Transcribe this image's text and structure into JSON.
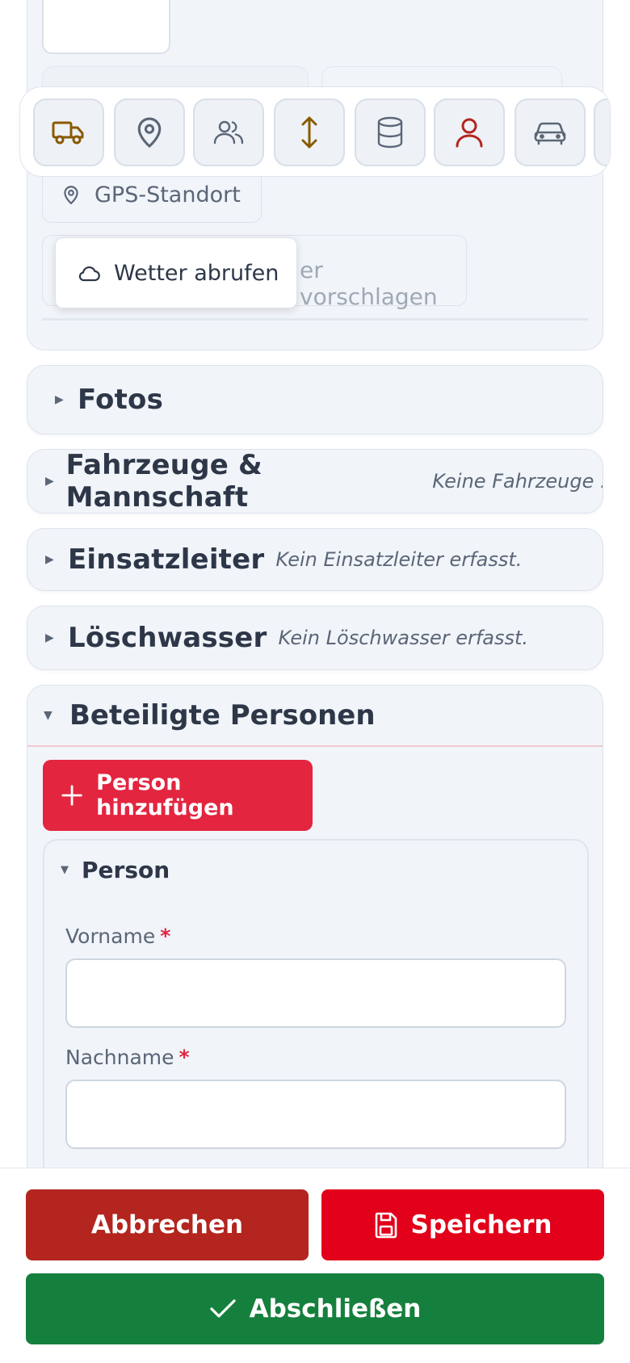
{
  "location": {
    "gps_label": "GPS-Standort",
    "suggest_label_visible": "er vorschlagen",
    "weather_label": "Wetter abrufen"
  },
  "toolbar": {
    "icons": [
      "truck-icon",
      "map-pin-icon",
      "users-icon",
      "arrows-up-down-icon",
      "database-icon",
      "user-icon",
      "car-icon"
    ],
    "colors": {
      "active": "#8a5a00",
      "person": "#b3251e",
      "default": "#5b6677"
    }
  },
  "sections": {
    "fotos": {
      "title": "Fotos"
    },
    "fahrzeuge": {
      "title": "Fahrzeuge & Mannschaft",
      "note": "Keine Fahrzeuge ..."
    },
    "einsatzleiter": {
      "title": "Einsatzleiter",
      "note": "Kein Einsatzleiter erfasst."
    },
    "loeschwasser": {
      "title": "Löschwasser",
      "note": "Kein Löschwasser erfasst."
    },
    "personen": {
      "title": "Beteiligte Personen",
      "add_label": "Person hinzufügen",
      "person": {
        "title": "Person",
        "vorname_label": "Vorname",
        "nachname_label": "Nachname",
        "required_mark": "*",
        "vorname_value": "",
        "nachname_value": ""
      }
    }
  },
  "actions": {
    "cancel": "Abbrechen",
    "save": "Speichern",
    "done": "Abschließen"
  },
  "colors": {
    "accent_red": "#e3253f",
    "cancel_red": "#b3251e",
    "save_red": "#e2001a",
    "done_green": "#15803d"
  }
}
